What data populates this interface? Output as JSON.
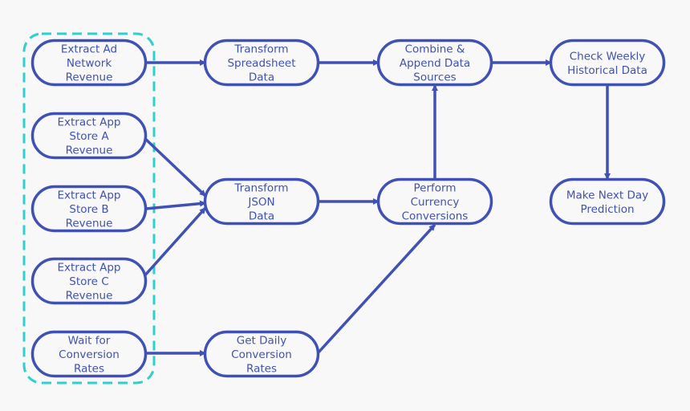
{
  "colors": {
    "node": "#3f51b5",
    "group": "#2ecfcf",
    "background": "#f8f8f8"
  },
  "nodes": [
    {
      "id": "adnet",
      "lines": [
        "Extract Ad",
        "Network",
        "Revenue"
      ]
    },
    {
      "id": "storeA",
      "lines": [
        "Extract  App",
        "Store A",
        "Revenue"
      ]
    },
    {
      "id": "storeB",
      "lines": [
        "Extract App",
        "Store B",
        "Revenue"
      ]
    },
    {
      "id": "storeC",
      "lines": [
        "Extract App",
        "Store C",
        "Revenue"
      ]
    },
    {
      "id": "wait",
      "lines": [
        "Wait for",
        "Conversion",
        "Rates"
      ]
    },
    {
      "id": "spreadsheet",
      "lines": [
        "Transform",
        "Spreadsheet",
        "Data"
      ]
    },
    {
      "id": "json",
      "lines": [
        "Transform",
        "JSON",
        "Data"
      ]
    },
    {
      "id": "daily",
      "lines": [
        "Get Daily",
        "Conversion",
        "Rates"
      ]
    },
    {
      "id": "combine",
      "lines": [
        "Combine &",
        "Append Data",
        "Sources"
      ]
    },
    {
      "id": "currency",
      "lines": [
        "Perform",
        "Currency",
        "Conversions"
      ]
    },
    {
      "id": "weekly",
      "lines": [
        "Check Weekly",
        "Historical Data"
      ]
    },
    {
      "id": "predict",
      "lines": [
        "Make Next Day",
        "Prediction"
      ]
    }
  ],
  "edges": [
    [
      "adnet",
      "spreadsheet"
    ],
    [
      "storeA",
      "json"
    ],
    [
      "storeB",
      "json"
    ],
    [
      "storeC",
      "json"
    ],
    [
      "wait",
      "daily"
    ],
    [
      "spreadsheet",
      "combine"
    ],
    [
      "json",
      "currency"
    ],
    [
      "daily",
      "currency"
    ],
    [
      "currency",
      "combine"
    ],
    [
      "combine",
      "weekly"
    ],
    [
      "weekly",
      "predict"
    ]
  ],
  "group": [
    "adnet",
    "storeA",
    "storeB",
    "storeC",
    "wait"
  ]
}
